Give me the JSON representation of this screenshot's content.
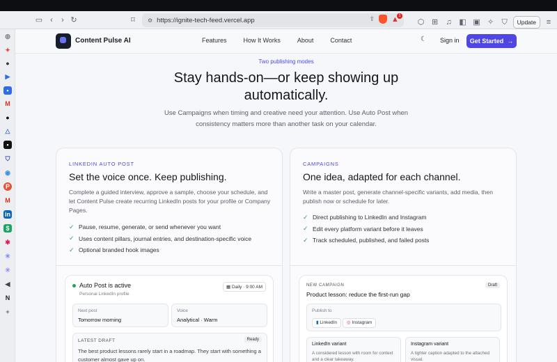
{
  "browser": {
    "url": "https://ignite-tech-feed.vercel.app",
    "update_label": "Update",
    "alert_count": "1"
  },
  "nav": {
    "brand": "Content Pulse AI",
    "links": [
      "Features",
      "How It Works",
      "About",
      "Contact"
    ],
    "signin": "Sign in",
    "cta": "Get Started"
  },
  "hero": {
    "eyebrow": "Two publishing modes",
    "headline_line1": "Stay hands-on—or keep showing up",
    "headline_line2": "automatically.",
    "subtext": "Use Campaigns when timing and creative need your attention. Use Auto Post when consistency matters more than another task on your calendar."
  },
  "autopost": {
    "label": "LINKEDIN AUTO POST",
    "title": "Set the voice once. Keep publishing.",
    "description": "Complete a guided interview, approve a sample, choose your schedule, and let Content Pulse create recurring LinkedIn posts for your profile or Company Pages.",
    "features": [
      "Pause, resume, generate, or send whenever you want",
      "Uses content pillars, journal entries, and destination-specific voice",
      "Optional branded hook images"
    ],
    "panel": {
      "status": "Auto Post is active",
      "profile": "Personal LinkedIn profile",
      "schedule": "Daily · 9:00 AM",
      "next_post_label": "Next post",
      "next_post_value": "Tomorrow morning",
      "voice_label": "Voice",
      "voice_value": "Analytical · Warm",
      "draft_label": "LATEST DRAFT",
      "draft_status": "Ready",
      "draft_text": "The best product lessons rarely start in a roadmap. They start with something a customer almost gave up on."
    }
  },
  "campaigns": {
    "label": "CAMPAIGNS",
    "title": "One idea, adapted for each channel.",
    "description": "Write a master post, generate channel-specific variants, add media, then publish now or schedule for later.",
    "features": [
      "Direct publishing to LinkedIn and Instagram",
      "Edit every platform variant before it leaves",
      "Track scheduled, published, and failed posts"
    ],
    "panel": {
      "label": "NEW CAMPAIGN",
      "title": "Product lesson: reduce the first-run gap",
      "status": "Draft",
      "publish_label": "Publish to",
      "channels": [
        "LinkedIn",
        "Instagram"
      ],
      "variants": [
        {
          "title": "LinkedIn variant",
          "text": "A considered lesson with room for context and a clear takeaway."
        },
        {
          "title": "Instagram variant",
          "text": "A tighter caption adapted to the attached visual."
        }
      ]
    }
  }
}
